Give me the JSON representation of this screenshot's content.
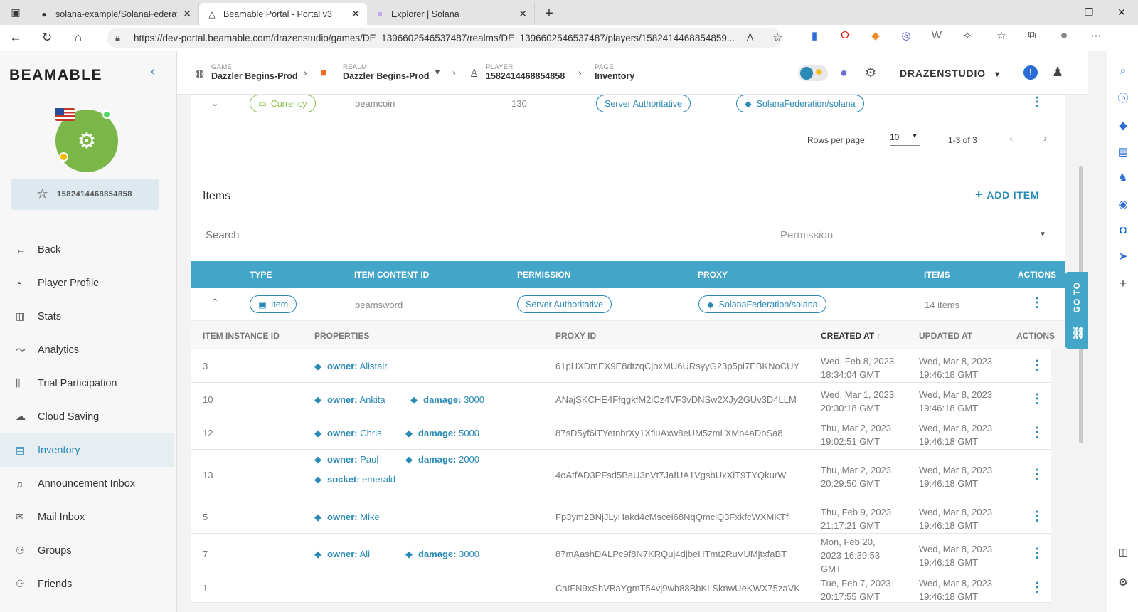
{
  "browser": {
    "tabs": [
      {
        "title": "solana-example/SolanaFederatio",
        "icon": "github-icon"
      },
      {
        "title": "Beamable Portal - Portal v3",
        "icon": "beamable-icon"
      },
      {
        "title": "Explorer | Solana",
        "icon": "solana-icon"
      }
    ],
    "url": "https://dev-portal.beamable.com/drazenstudio/games/DE_1396602546537487/realms/DE_1396602546537487/players/1582414468854859..."
  },
  "sidebar": {
    "logo": "BEAMABLE",
    "player_id": "1582414468854858",
    "items": [
      {
        "label": "Back",
        "icon": "arrow-left-icon"
      },
      {
        "label": "Player Profile",
        "icon": "profile-icon"
      },
      {
        "label": "Stats",
        "icon": "bar-chart-icon"
      },
      {
        "label": "Analytics",
        "icon": "trend-icon"
      },
      {
        "label": "Trial Participation",
        "icon": "sliders-icon"
      },
      {
        "label": "Cloud Saving",
        "icon": "cloud-icon"
      },
      {
        "label": "Inventory",
        "icon": "inventory-icon"
      },
      {
        "label": "Announcement Inbox",
        "icon": "bell-icon"
      },
      {
        "label": "Mail Inbox",
        "icon": "mail-icon"
      },
      {
        "label": "Groups",
        "icon": "groups-icon"
      },
      {
        "label": "Friends",
        "icon": "friends-icon"
      }
    ]
  },
  "header": {
    "game_label": "GAME",
    "game_value": "Dazzler Begins-Prod",
    "realm_label": "REALM",
    "realm_value": "Dazzler Begins-Prod",
    "player_label": "PLAYER",
    "player_value": "1582414468854858",
    "page_label": "PAGE",
    "page_value": "Inventory",
    "org": "DRAZENSTUDIO"
  },
  "currency_row": {
    "type": "Currency",
    "content_id": "beamcoin",
    "amount": "130",
    "permission": "Server Authoritative",
    "proxy": "SolanaFederation/solana"
  },
  "pagination": {
    "rows_label": "Rows per page:",
    "rows_value": "10",
    "range": "1-3 of 3"
  },
  "items_section": {
    "title": "Items",
    "add_label": "ADD ITEM",
    "search_placeholder": "Search",
    "permission_placeholder": "Permission"
  },
  "items_table": {
    "headers": {
      "type": "TYPE",
      "content_id": "ITEM CONTENT ID",
      "permission": "PERMISSION",
      "proxy": "PROXY",
      "items": "ITEMS",
      "actions": "ACTIONS"
    },
    "row": {
      "type": "Item",
      "content_id": "beamsword",
      "permission": "Server Authoritative",
      "proxy": "SolanaFederation/solana",
      "count": "14 items"
    }
  },
  "instances": {
    "headers": {
      "id": "ITEM INSTANCE ID",
      "properties": "PROPERTIES",
      "proxy_id": "PROXY ID",
      "created": "CREATED AT",
      "updated": "UPDATED AT",
      "actions": "ACTIONS"
    },
    "rows": [
      {
        "id": "3",
        "p1k": "owner:",
        "p1v": "Alistair",
        "proxy": "61pHXDmEX9E8dtzqCjoxMU6URsyyG23p5pi7EBKNoCUY",
        "c1": "Wed, Feb 8, 2023",
        "c2": "18:34:04 GMT",
        "u1": "Wed, Mar 8, 2023",
        "u2": "19:46:18 GMT"
      },
      {
        "id": "10",
        "p1k": "owner:",
        "p1v": "Ankita",
        "p2k": "damage:",
        "p2v": "3000",
        "proxy": "ANajSKCHE4FfqgkfM2iCz4VF3vDNSw2XJy2GUv3D4LLM",
        "c1": "Wed, Mar 1, 2023",
        "c2": "20:30:18 GMT",
        "u1": "Wed, Mar 8, 2023",
        "u2": "19:46:18 GMT"
      },
      {
        "id": "12",
        "p1k": "owner:",
        "p1v": "Chris",
        "p2k": "damage:",
        "p2v": "5000",
        "proxy": "87sD5yf6iTYetnbrXy1XfiuAxw8eUM5zmLXMb4aDbSa8",
        "c1": "Thu, Mar 2, 2023",
        "c2": "19:02:51 GMT",
        "u1": "Wed, Mar 8, 2023",
        "u2": "19:46:18 GMT"
      },
      {
        "id": "13",
        "p1k": "owner:",
        "p1v": "Paul",
        "p2k": "damage:",
        "p2v": "2000",
        "p3k": "socket:",
        "p3v": "emerald",
        "proxy": "4oAtfAD3PFsd5BaU3nVt7JafUA1VgsbUxXiT9TYQkurW",
        "c1": "Thu, Mar 2, 2023",
        "c2": "20:29:50 GMT",
        "u1": "Wed, Mar 8, 2023",
        "u2": "19:46:18 GMT"
      },
      {
        "id": "5",
        "p1k": "owner:",
        "p1v": "Mike",
        "proxy": "Fp3ym2BNjJLyHakd4cMscei68NqQmciQ3FxkfcWXMKTf",
        "c1": "Thu, Feb 9, 2023",
        "c2": "21:17:21 GMT",
        "u1": "Wed, Mar 8, 2023",
        "u2": "19:46:18 GMT"
      },
      {
        "id": "7",
        "p1k": "owner:",
        "p1v": "Ali",
        "p2k": "damage:",
        "p2v": "3000",
        "proxy": "87mAashDALPc9f8N7KRQuj4djbeHTmt2RuVUMjtxfaBT",
        "c1": "Mon, Feb 20,",
        "c2": "2023 16:39:53",
        "c3": "GMT",
        "u1": "Wed, Mar 8, 2023",
        "u2": "19:46:18 GMT"
      },
      {
        "id": "1",
        "p1k": "-",
        "proxy": "CatFN9xShVBaYgmT54vj9wb88BbKLSknwUeKWX75zaVK",
        "c1": "Tue, Feb 7, 2023",
        "c2": "20:17:55 GMT",
        "u1": "Wed, Mar 8, 2023",
        "u2": "19:46:18 GMT"
      }
    ]
  },
  "goto_label": "GO TO",
  "colors": {
    "accent": "#2a8ab5",
    "header": "#43a6c9",
    "avatar": "#7ab648"
  }
}
